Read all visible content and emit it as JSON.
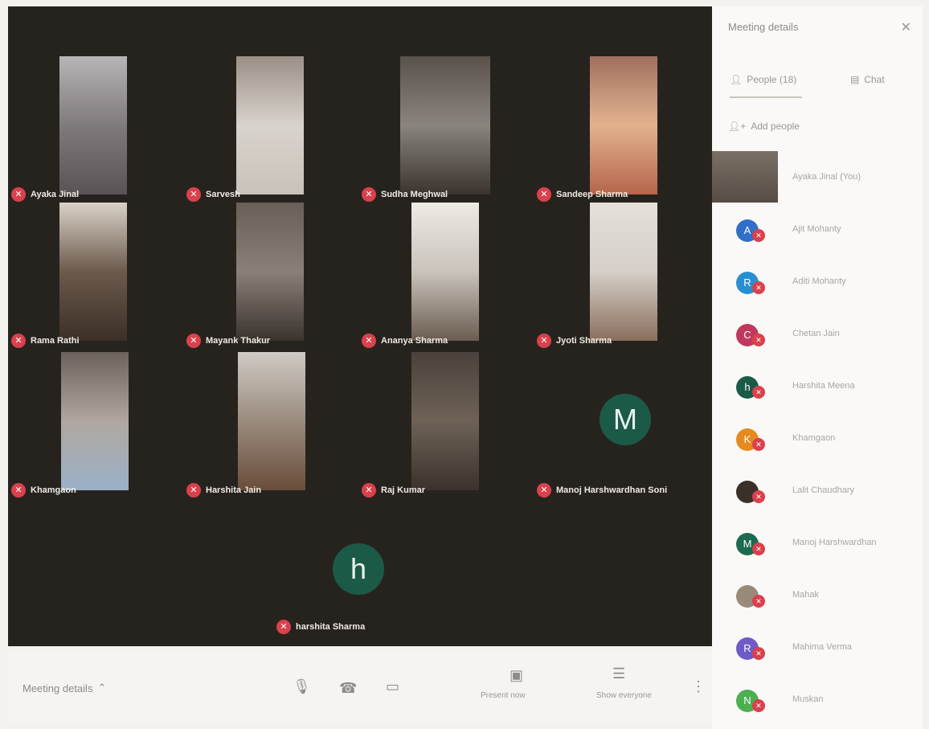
{
  "stage": {
    "tiles": [
      {
        "name": "Ayaka Jinal"
      },
      {
        "name": "Sarvesh"
      },
      {
        "name": "Sudha Meghwal"
      },
      {
        "name": "Sandeep Sharma"
      },
      {
        "name": "Rama Rathi"
      },
      {
        "name": "Mayank Thakur"
      },
      {
        "name": "Ananya Sharma"
      },
      {
        "name": "Jyoti Sharma"
      },
      {
        "name": "Khamgaon"
      },
      {
        "name": "Harshita Jain"
      },
      {
        "name": "Raj Kumar"
      },
      {
        "name": "Manoj Harshwardhan Soni",
        "initial": "M"
      }
    ],
    "bottom": {
      "initial": "h",
      "name": "harshita Sharma"
    }
  },
  "toolbar": {
    "meeting_details": "Meeting details",
    "present_label": "Present now",
    "chat_label": "Show everyone"
  },
  "panel": {
    "title": "Meeting details",
    "tab_people": "People (18)",
    "tab_chat": "Chat",
    "add_people": "Add people",
    "participants": [
      {
        "name": "Ayaka Jinal (You)",
        "initial": "",
        "color": "#7a6f65"
      },
      {
        "name": "Ajit Mohanty",
        "initial": "A",
        "color": "#2f6fc9"
      },
      {
        "name": "Aditi Mohanty",
        "initial": "R",
        "color": "#2a8fd0"
      },
      {
        "name": "Chetan Jain",
        "initial": "C",
        "color": "#c0395c"
      },
      {
        "name": "Harshita Meena",
        "initial": "h",
        "color": "#1c5a48"
      },
      {
        "name": "Khamgaon",
        "initial": "K",
        "color": "#e58a1f"
      },
      {
        "name": "Lalit Chaudhary",
        "initial": "",
        "color": "#3b2f2a"
      },
      {
        "name": "Manoj Harshwardhan",
        "initial": "M",
        "color": "#1c6a50"
      },
      {
        "name": "Mahak",
        "initial": "",
        "color": "#9a8a7a"
      },
      {
        "name": "Mahima Verma",
        "initial": "R",
        "color": "#6e5bc9"
      },
      {
        "name": "Muskan",
        "initial": "N",
        "color": "#4caf50"
      }
    ]
  }
}
